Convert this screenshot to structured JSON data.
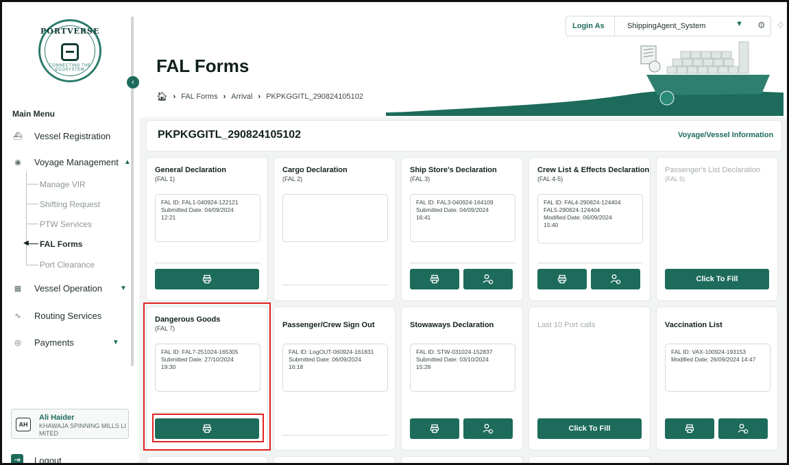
{
  "sidebar": {
    "logo": {
      "name": "PORTVERSE",
      "tagline": "CONNECTING THE ECOSYSTEM"
    },
    "menu_heading": "Main Menu",
    "items": [
      {
        "label": "Vessel Registration",
        "icon": "ship-icon"
      },
      {
        "label": "Voyage Management",
        "icon": "compass-icon",
        "expanded": true
      },
      {
        "label": "Vessel Operation",
        "icon": "crane-icon"
      },
      {
        "label": "Routing Services",
        "icon": "route-icon"
      },
      {
        "label": "Payments",
        "icon": "payment-icon"
      }
    ],
    "voyage_subitems": [
      "Manage VIR",
      "Shifting Request",
      "PTW Services",
      "FAL Forms",
      "Port Clearance"
    ],
    "active_subitem": "FAL Forms",
    "user": {
      "initials": "AH",
      "name": "Ali Haider",
      "organization": "KHAWAJA SPINNING MILLS LI MITED"
    },
    "logout_label": "Logout"
  },
  "topbar": {
    "login_as_label": "Login As",
    "login_as_value": "ShippingAgent_System"
  },
  "header": {
    "title": "FAL Forms",
    "breadcrumb": [
      "FAL Forms",
      "Arrival",
      "PKPKGGITL_290824105102"
    ]
  },
  "vessel": {
    "id": "PKPKGGITL_290824105102",
    "info_link": "Voyage/Vessel Information"
  },
  "cards": [
    {
      "title": "General Declaration",
      "code": "(FAL 1)",
      "lines": [
        "FAL ID: FAL1-040924-122121",
        "Submitted Date: 04/09/2024",
        "12:21"
      ]
    },
    {
      "title": "Cargo Declaration",
      "code": "(FAL 2)",
      "lines": []
    },
    {
      "title": "Ship Store's Declaration",
      "code": "(FAL 3)",
      "lines": [
        "FAL ID: FAL3-040924-164109",
        "Submitted Date: 04/09/2024",
        "16:41"
      ]
    },
    {
      "title": "Crew List & Effects Declaration",
      "code": "(FAL 4-5)",
      "lines": [
        "FAL ID: FAL4-290824-124404",
        "FAL5-290824-124404",
        "Modified Date: 06/09/2024",
        "15:40"
      ]
    },
    {
      "title": "Passenger's List Declaration",
      "code": "(FAL 6)",
      "button": "Click To Fill"
    },
    {
      "title": "Dangerous Goods",
      "code": "(FAL 7)",
      "lines": [
        "FAL ID: FAL7-251024-165305",
        "Submitted Date: 27/10/2024",
        "19:30"
      ]
    },
    {
      "title": "Passenger/Crew Sign Out",
      "lines": [
        "FAL ID: LogOUT-060924-161831",
        "Submitted Date: 06/09/2024",
        "16:18"
      ]
    },
    {
      "title": "Stowaways Declaration",
      "lines": [
        "FAL ID: STW-031024-152837",
        "Submitted Date: 03/10/2024",
        "15:28"
      ]
    },
    {
      "title": "Last 10 Port calls",
      "button": "Click To Fill"
    },
    {
      "title": "Vaccination List",
      "lines": [
        "FAL ID: VAX-100924-193153",
        "Modified Date: 26/09/2024 14:47"
      ]
    }
  ],
  "colors": {
    "primary": "#1c6b5b",
    "highlight": "#e02020",
    "panel": "#f2f4f3"
  }
}
